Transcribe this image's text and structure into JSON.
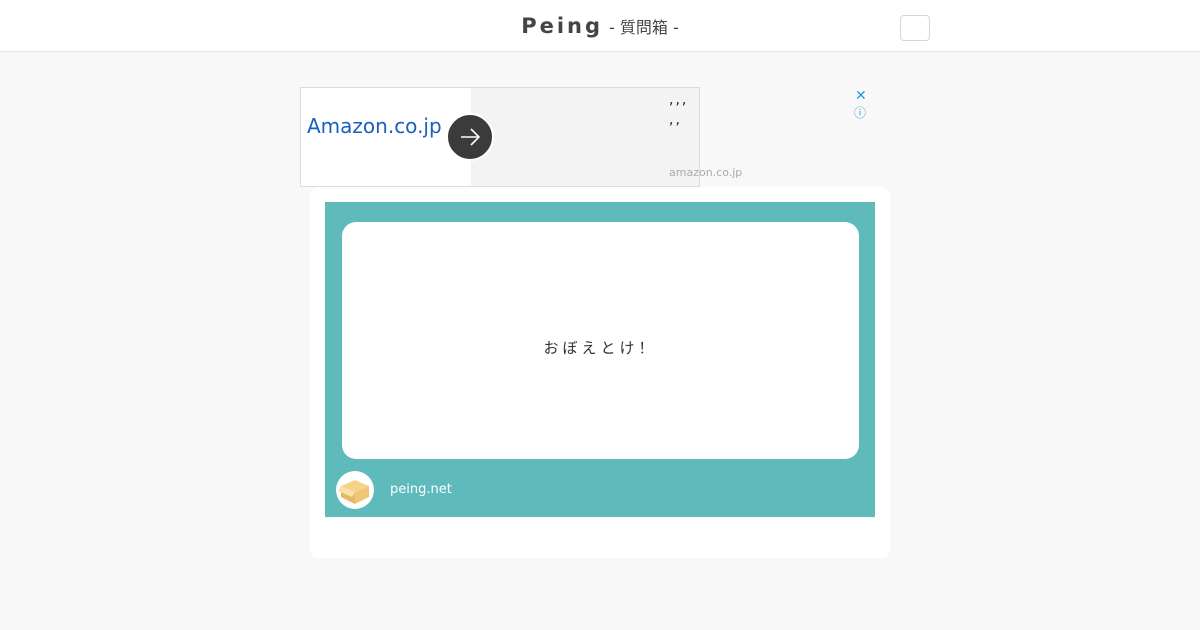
{
  "header": {
    "brand": "Peing",
    "subtitle": "- 質問箱 -"
  },
  "ad": {
    "brand": "Amazon.co.jp",
    "line1": ",,,",
    "line2": ",,",
    "domain": "amazon.co.jp",
    "close_glyph": "✕",
    "info_glyph": "ⓘ",
    "arrow_icon": "arrow-right-icon",
    "brand_color": "#1a5fc2"
  },
  "card": {
    "question": "おぼえとけ！",
    "site": "peing.net",
    "background_color": "#5fbbbb",
    "avatar_icon": "cardboard-box-icon"
  }
}
